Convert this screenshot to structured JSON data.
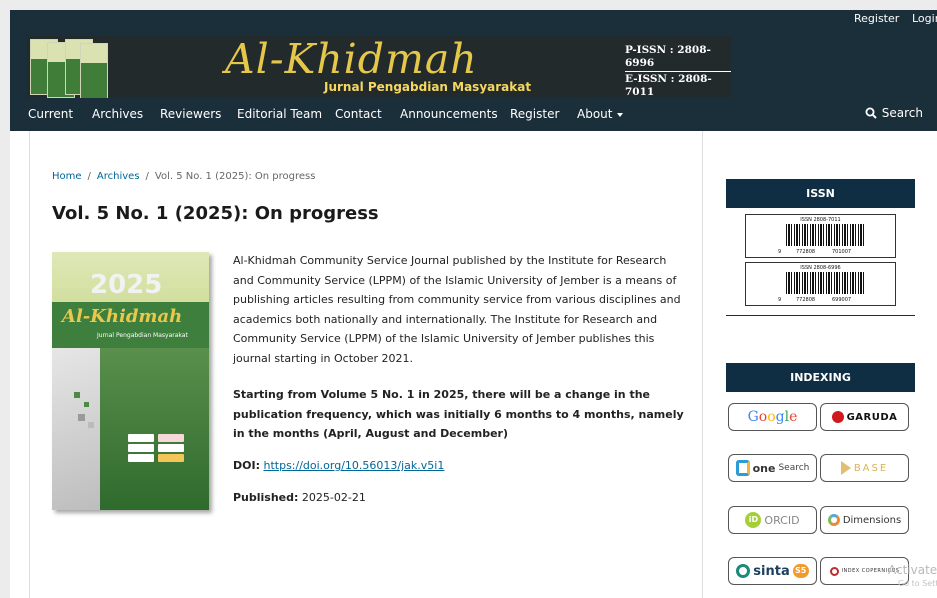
{
  "top_links": {
    "register": "Register",
    "login": "Login"
  },
  "banner": {
    "title": "Al-Khidmah",
    "subtitle": "Jurnal Pengabdian Masyarakat",
    "p_issn": "P-ISSN : 2808-6996",
    "e_issn": "E-ISSN : 2808-7011"
  },
  "nav": {
    "items": [
      "Current",
      "Archives",
      "Reviewers",
      "Editorial Team",
      "Contact",
      "Announcements",
      "Register",
      "About"
    ],
    "search": "Search"
  },
  "breadcrumb": {
    "home": "Home",
    "archives": "Archives",
    "current": "Vol. 5 No. 1 (2025): On progress"
  },
  "issue": {
    "title": "Vol. 5 No. 1 (2025): On progress",
    "abstract": "Al-Khidmah Community Service Journal published by the Institute for Research and Community Service (LPPM) of the Islamic University of Jember is a means of publishing articles resulting from community service from various disciplines and academics both nationally and internationally. The Institute for Research and Community Service (LPPM) of the Islamic University of Jember publishes this journal starting in October 2021.",
    "notice": "Starting from Volume 5 No. 1 in 2025, there will be a change in the publication frequency, which was initially 6 months to 4 months, namely in the months (April, August and December)",
    "doi_label": "DOI:",
    "doi_link": "https://doi.org/10.56013/jak.v5i1",
    "published_label": "Published:",
    "published_date": "2025-02-21"
  },
  "cover": {
    "year": "2025",
    "title": "Al-Khidmah",
    "subtitle": "Jurnal Pengabdian Masyarakat"
  },
  "sidebar": {
    "issn_heading": "ISSN",
    "barcodes": [
      {
        "label": "ISSN 2808-7011",
        "left_digit": "9",
        "mid": "772808",
        "right": "701007"
      },
      {
        "label": "ISSN 2808-6996",
        "left_digit": "9",
        "mid": "772808",
        "right": "699007"
      }
    ],
    "indexing_heading": "INDEXING",
    "indexing": {
      "google": "Google",
      "garuda": "GARUDA",
      "onesearch": "onesearch",
      "onesearch_one": "one",
      "onesearch_rest": "Search",
      "base": "BASE",
      "orcid_id": "iD",
      "orcid": "ORCID",
      "dimensions": "Dimensions",
      "sinta": "sinta",
      "sinta_level": "S5",
      "copernicus": "INDEX COPERNICUS"
    }
  },
  "watermark": {
    "line1": "Activate",
    "line2": "Go to Settir"
  },
  "colors": {
    "header_bg": "#1b2f3a",
    "link": "#006798",
    "side_heading_bg": "#0f2e44"
  }
}
